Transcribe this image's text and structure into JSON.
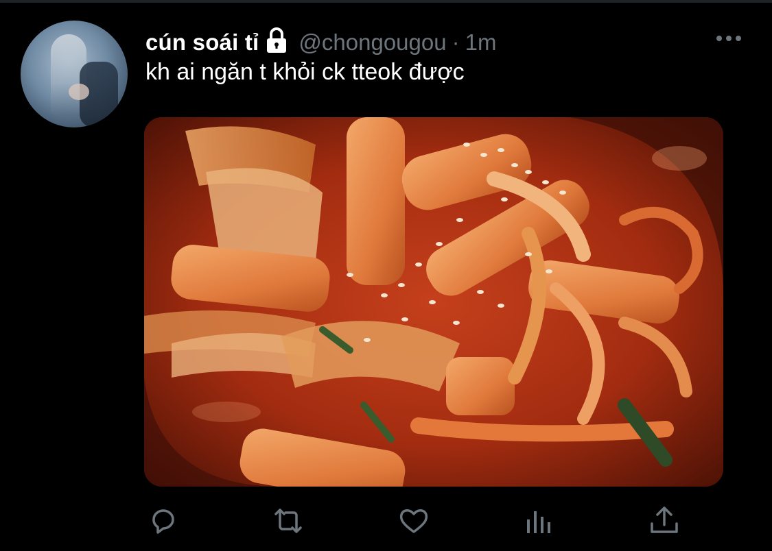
{
  "tweet": {
    "display_name": "cún soái tỉ",
    "handle": "@chongougou",
    "separator": "·",
    "time": "1m",
    "text": "kh ai ngăn t khỏi ck tteok được",
    "protected_icon": "lock-icon",
    "more_icon": "more-dots-icon",
    "media": {
      "subject": "tteokbokki",
      "icon": "photo"
    }
  },
  "actions": [
    {
      "name": "reply",
      "icon": "reply-icon"
    },
    {
      "name": "retweet",
      "icon": "retweet-icon"
    },
    {
      "name": "like",
      "icon": "heart-icon"
    },
    {
      "name": "analytics",
      "icon": "analytics-icon"
    },
    {
      "name": "share",
      "icon": "share-icon"
    }
  ],
  "colors": {
    "background": "#000000",
    "text_primary": "#ffffff",
    "text_secondary": "#6e767d",
    "icon": "#6e767d"
  }
}
